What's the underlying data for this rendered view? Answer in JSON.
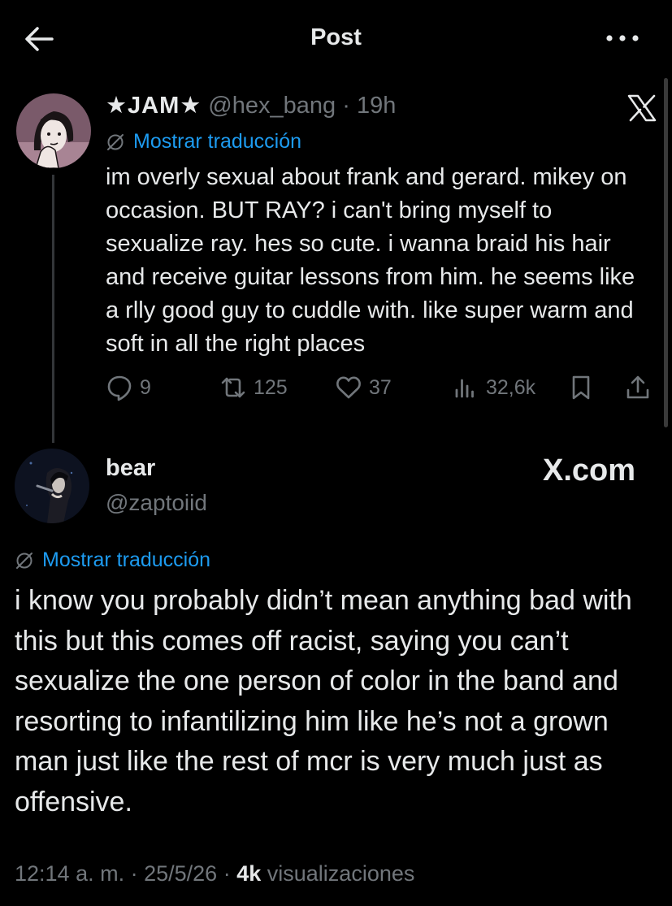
{
  "header": {
    "title": "Post",
    "back_icon": "arrow-left-icon",
    "more_icon": "more-horizontal-icon"
  },
  "quoted_post": {
    "display_name": "★JAM★",
    "handle": "@hex_bang",
    "separator": "·",
    "time": "19h",
    "translate_label": "Mostrar traducción",
    "text": "im overly sexual about frank and gerard. mikey on occasion. BUT RAY? i can't bring myself to sexualize ray. hes so cute. i wanna braid his hair and receive guitar lessons from him. he seems like a rlly good guy to cuddle with. like super warm and soft in all the right places",
    "stats": {
      "replies": "9",
      "reposts": "125",
      "likes": "37",
      "views": "32,6k"
    }
  },
  "reply_post": {
    "display_name": "bear",
    "handle": "@zaptoiid",
    "watermark": "X.com",
    "translate_label": "Mostrar traducción",
    "text": "i know you probably didn’t mean anything bad with this but this comes off racist, saying you can’t sexualize the one person of color in the band and resorting to infantilizing him like he’s not a grown man just like the rest of mcr is very much just as offensive.",
    "time": "12:14 a. m.",
    "date": "25/5/26",
    "views_count": "4k",
    "views_label": "visualizaciones"
  },
  "colors": {
    "background": "#000000",
    "text": "#e7e9ea",
    "muted": "#71767b",
    "accent": "#1d9bf0",
    "divider": "#333639"
  }
}
